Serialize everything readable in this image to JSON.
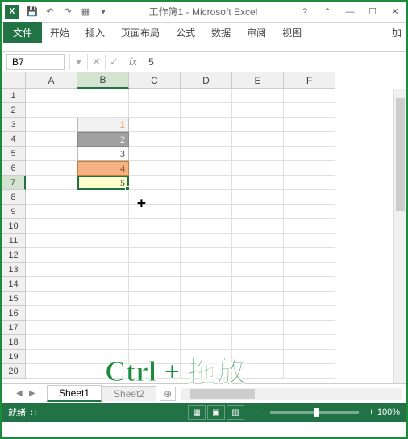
{
  "titlebar": {
    "app_abbrev": "X",
    "title": "工作簿1 - Microsoft Excel",
    "help": "?",
    "chevron": "⌃"
  },
  "tabs": {
    "file": "文件",
    "home": "开始",
    "insert": "插入",
    "page_layout": "页面布局",
    "formulas": "公式",
    "data": "数据",
    "review": "审阅",
    "view": "视图",
    "addins": "加"
  },
  "formula_bar": {
    "name_box": "B7",
    "fx": "fx",
    "value": "5"
  },
  "columns": [
    "A",
    "B",
    "C",
    "D",
    "E",
    "F"
  ],
  "rows": [
    "1",
    "2",
    "3",
    "4",
    "5",
    "6",
    "7",
    "8",
    "9",
    "10",
    "11",
    "12",
    "13",
    "14",
    "15",
    "16",
    "17",
    "18",
    "19",
    "20"
  ],
  "cells": {
    "B3": "1",
    "B4": "2",
    "B5": "3",
    "B6": "4",
    "B7": "5"
  },
  "overlay": "Ctrl + 拖放",
  "sheets": {
    "sheet1": "Sheet1",
    "sheet2": "Sheet2",
    "add": "⊕"
  },
  "statusbar": {
    "ready": "就绪",
    "scroll": "∷",
    "zoom": "100%",
    "minus": "−",
    "plus": "+"
  },
  "chart_data": {
    "type": "table",
    "title": "Sequential fill values in column B",
    "series": [
      {
        "name": "B",
        "values": [
          1,
          2,
          3,
          4,
          5
        ]
      }
    ]
  }
}
